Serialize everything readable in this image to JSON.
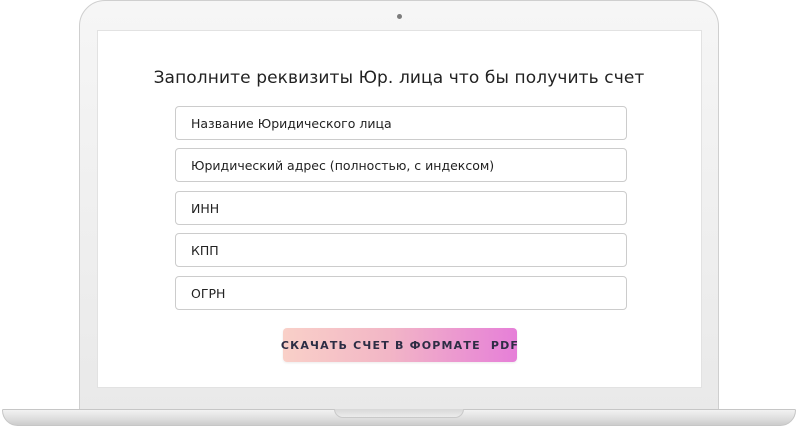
{
  "form": {
    "title": "Заполните реквизиты Юр. лица что бы получить счет",
    "fields": [
      {
        "placeholder": "Название Юридического лица"
      },
      {
        "placeholder": "Юридический адрес (полностью, с индексом)"
      },
      {
        "placeholder": "ИНН"
      },
      {
        "placeholder": "КПП"
      },
      {
        "placeholder": "ОГРН"
      }
    ],
    "download_button": "СКАЧАТЬ СЧЕТ В ФОРМАТЕ  PDF"
  },
  "colors": {
    "button_gradient_start": "#f9d0c8",
    "button_gradient_end": "#e67fd8",
    "text": "#222222"
  },
  "icons": [
    "laptop-camera-icon"
  ]
}
